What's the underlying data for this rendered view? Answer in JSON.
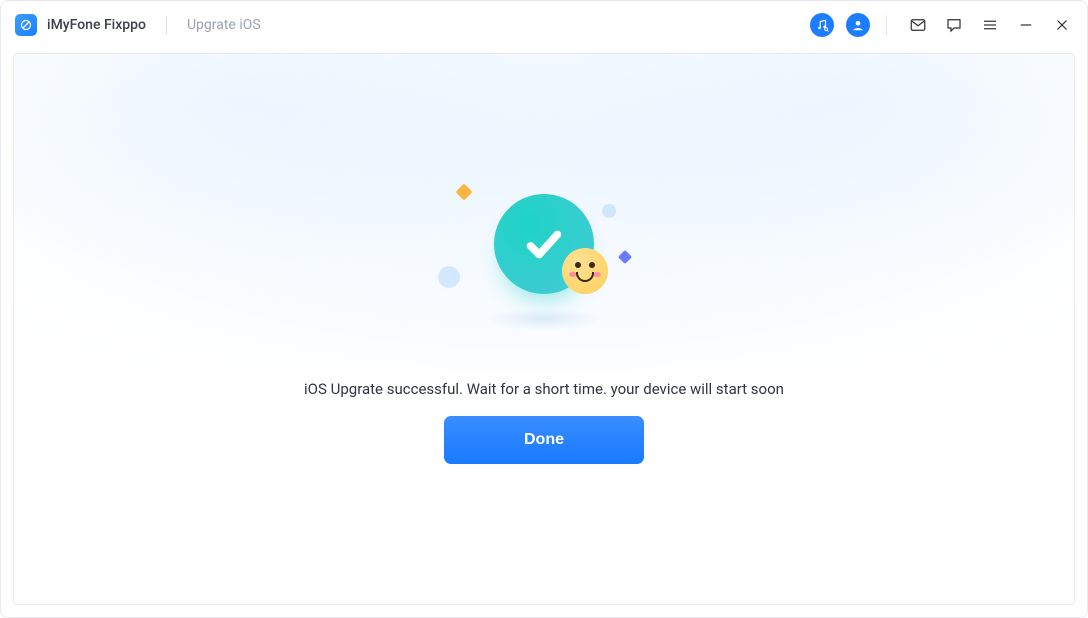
{
  "header": {
    "app_title": "iMyFone Fixppo",
    "breadcrumb": "Upgrate iOS"
  },
  "icons": {
    "itunes": "music-search-icon",
    "user": "user-icon",
    "mail": "mail-icon",
    "feedback": "speech-bubble-icon",
    "menu": "hamburger-icon",
    "minimize": "minimize-icon",
    "close": "close-icon"
  },
  "main": {
    "status_text": "iOS Upgrate successful. Wait for a short time. your device will start soon",
    "done_label": "Done"
  },
  "colors": {
    "accent": "#1c7dff",
    "success": "#1ed3c5"
  }
}
